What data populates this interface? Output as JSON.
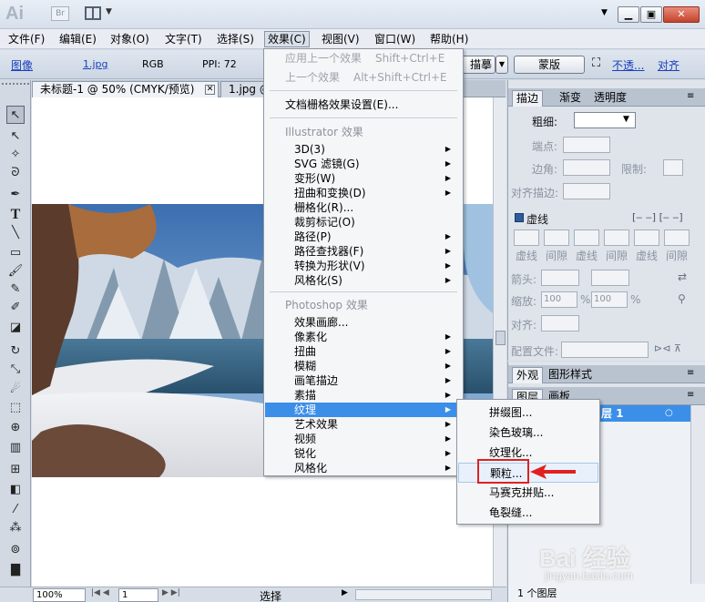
{
  "titlebar": {
    "logo": "Ai",
    "bridge": "Br"
  },
  "menubar": [
    "文件(F)",
    "编辑(E)",
    "对象(O)",
    "文字(T)",
    "选择(S)",
    "效果(C)",
    "视图(V)",
    "窗口(W)",
    "帮助(H)"
  ],
  "controlbar": {
    "type": "图像",
    "filename": "1.jpg",
    "mode": "RGB",
    "ppi": "PPI: 72",
    "trace": "描摹",
    "mask": "蒙版",
    "opacity": "不透...",
    "align": "对齐"
  },
  "tabs": [
    {
      "label": "未标题-1 @ 50% (CMYK/预览)",
      "close": "✕"
    },
    {
      "label": "1.jpg @",
      "close": ""
    }
  ],
  "effect_menu": {
    "apply_last": "应用上一个效果",
    "apply_last_shortcut": "Shift+Ctrl+E",
    "last_effect": "上一个效果",
    "last_effect_shortcut": "Alt+Shift+Ctrl+E",
    "raster_settings": "文档栅格效果设置(E)...",
    "ai_header": "Illustrator 效果",
    "ai_items": [
      "3D(3)",
      "SVG 滤镜(G)",
      "变形(W)",
      "扭曲和变换(D)",
      "栅格化(R)...",
      "裁剪标记(O)",
      "路径(P)",
      "路径查找器(F)",
      "转换为形状(V)",
      "风格化(S)"
    ],
    "ps_header": "Photoshop 效果",
    "ps_items": [
      "效果画廊...",
      "像素化",
      "扭曲",
      "模糊",
      "画笔描边",
      "素描",
      "纹理",
      "艺术效果",
      "视频",
      "锐化",
      "风格化"
    ]
  },
  "texture_submenu": [
    "拼缀图...",
    "染色玻璃...",
    "纹理化...",
    "颗粒...",
    "马赛克拼贴...",
    "龟裂缝..."
  ],
  "stroke_panel": {
    "tabs": [
      "描边",
      "渐变",
      "透明度"
    ],
    "weight": "粗细:",
    "cap": "端点:",
    "corner": "边角:",
    "limit": "限制:",
    "align_stroke": "对齐描边:",
    "dashed": "虚线",
    "dash_labels": [
      "虚线",
      "间隙",
      "虚线",
      "间隙",
      "虚线",
      "间隙"
    ],
    "arrow": "箭头:",
    "scale": "缩放:",
    "scale_val": "100",
    "pct": "%",
    "align": "对齐:",
    "profile": "配置文件:"
  },
  "appearance_panel": {
    "tabs": [
      "外观",
      "图形样式"
    ]
  },
  "layers_panel": {
    "tabs": [
      "图层",
      "画板"
    ],
    "layer_name": "层 1",
    "count": "1 个图层"
  },
  "statusbar": {
    "zoom": "100%",
    "page": "1",
    "tool": "选择"
  },
  "watermark": {
    "main": "Bai 经验",
    "sub": "jingyan.baidu.com"
  },
  "colors": {
    "highlight": "#3b8fe8",
    "red_box": "#e02020",
    "link": "#1a3fbd"
  }
}
